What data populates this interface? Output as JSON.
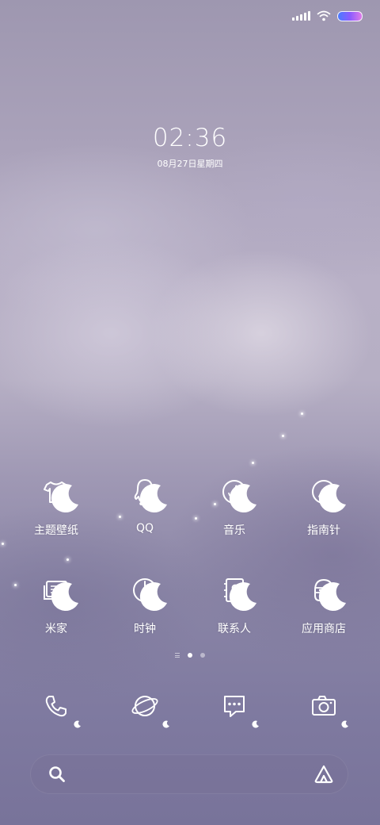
{
  "lockscreen": {
    "time": "02:36",
    "date": "08月27日星期四"
  },
  "apps": [
    {
      "label": "主题壁纸",
      "icon": "tshirt-icon"
    },
    {
      "label": "QQ",
      "icon": "qq-penguin-icon"
    },
    {
      "label": "音乐",
      "icon": "music-disc-icon"
    },
    {
      "label": "指南针",
      "icon": "compass-icon"
    },
    {
      "label": "米家",
      "icon": "mijia-icon"
    },
    {
      "label": "时钟",
      "icon": "clock-icon"
    },
    {
      "label": "联系人",
      "icon": "contacts-icon"
    },
    {
      "label": "应用商店",
      "icon": "app-store-icon"
    }
  ],
  "dock": [
    {
      "icon": "phone-icon"
    },
    {
      "icon": "browser-planet-icon"
    },
    {
      "icon": "messages-icon"
    },
    {
      "icon": "camera-icon"
    }
  ],
  "pager": {
    "pages": 2,
    "current": 1
  },
  "search": {
    "left_icon": "search-icon",
    "right_icon": "assistant-icon"
  },
  "status": {
    "battery_accent": "#8a5cff"
  }
}
